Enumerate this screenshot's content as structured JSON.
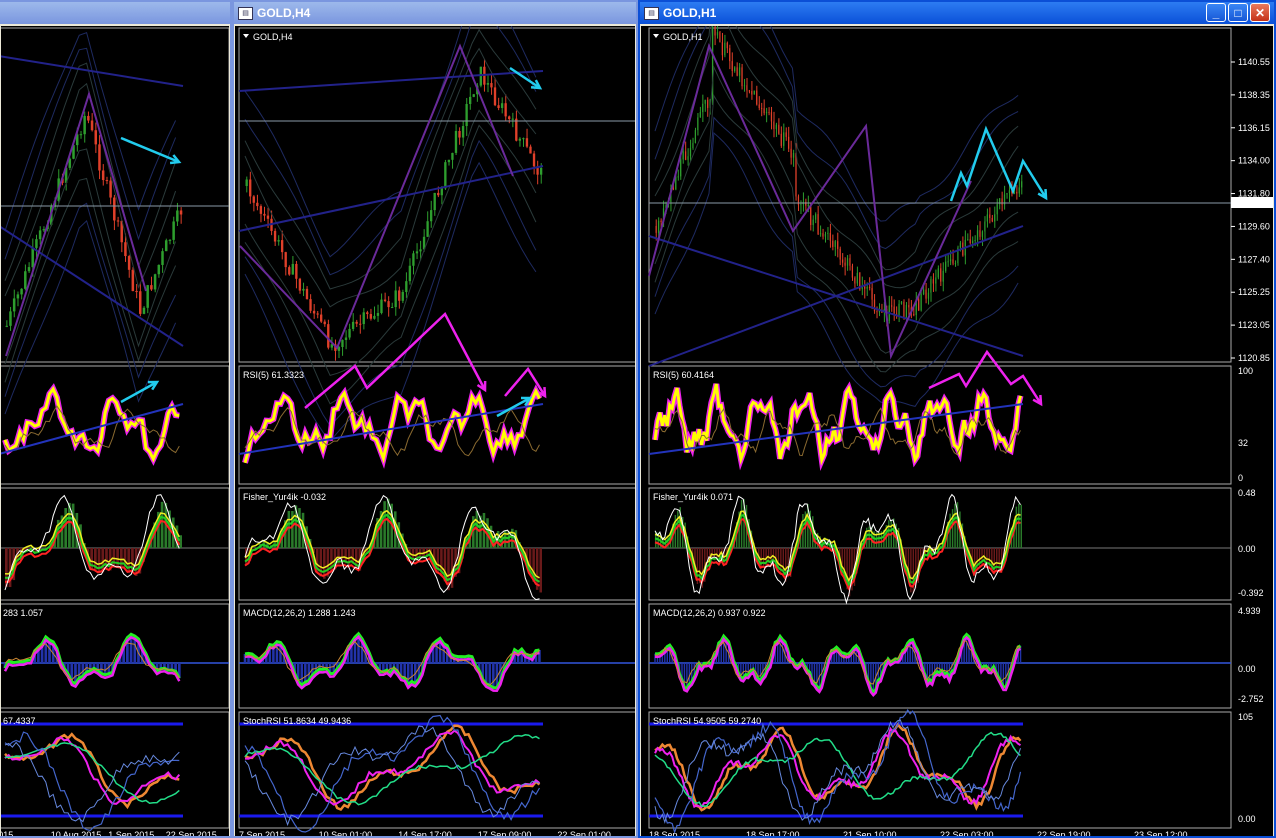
{
  "windows": [
    {
      "id": "left",
      "title": "",
      "active": false,
      "panes": {
        "fisher_label": "",
        "macd_label": "283 1.057",
        "stochrsi_label": "67.4337",
        "rsi_label": ""
      },
      "xaxis": [
        "2015",
        "10 Aug 2015",
        "1 Sep 2015",
        "22 Sep 2015"
      ]
    },
    {
      "id": "middle",
      "title": "GOLD,H4",
      "active": false,
      "panes": {
        "main_label": "GOLD,H4",
        "rsi_label": "RSI(5) 61.3323",
        "fisher_label": "Fisher_Yur4ik -0.032",
        "macd_label": "MACD(12,26,2) 1.288 1.243",
        "stochrsi_label": "StochRSI 51.8634 49.9436"
      },
      "xaxis": [
        "7 Sep 2015",
        "10 Sep 01:00",
        "14 Sep 17:00",
        "17 Sep 09:00",
        "22 Sep 01:00"
      ]
    },
    {
      "id": "right",
      "title": "GOLD,H1",
      "active": true,
      "panes": {
        "main_label": "GOLD,H1",
        "rsi_label": "RSI(5) 60.4164",
        "fisher_label": "Fisher_Yur4ik 0.071",
        "macd_label": "MACD(12,26,2) 0.937 0.922",
        "stochrsi_label": "StochRSI 54.9505 59.2740"
      },
      "price_axis": [
        "1140.55",
        "1138.35",
        "1136.15",
        "1134.00",
        "1131.80",
        "1129.60",
        "1127.40",
        "1125.25",
        "1123.05",
        "1120.85"
      ],
      "current_price": "1131.21",
      "rsi_axis": [
        "100",
        "32",
        "0"
      ],
      "fisher_axis": [
        "0.48",
        "0.00",
        "-0.392"
      ],
      "macd_axis": [
        "4.939",
        "0.00",
        "-2.752"
      ],
      "stoch_axis": [
        "105",
        "0.00"
      ],
      "xaxis": [
        "18 Sep 2015",
        "18 Sep 17:00",
        "21 Sep 10:00",
        "22 Sep 03:00",
        "22 Sep 19:00",
        "23 Sep 12:00"
      ]
    }
  ],
  "buttons": {
    "minimize": "_",
    "maximize": "□",
    "close": "✕"
  },
  "colors": {
    "bull": "#2e9e2e",
    "bear": "#e0402a",
    "rsi": "#ffff00",
    "arrow_cyan": "#22ccee",
    "arrow_magenta": "#ee22ee",
    "zigzag": "#5a2a8a",
    "band": "#1a1a6a",
    "active_title": "#0a50d8",
    "inactive_title": "#7a96df"
  }
}
